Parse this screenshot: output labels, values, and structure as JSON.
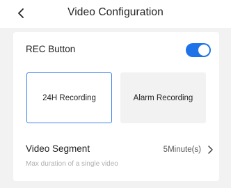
{
  "header": {
    "title": "Video Configuration",
    "back_icon": "chevron-left-icon"
  },
  "rec_button": {
    "label": "REC Button",
    "enabled": true,
    "toggle_color": "#1e73e8"
  },
  "modes": [
    {
      "label": "24H Recording",
      "selected": true
    },
    {
      "label": "Alarm Recording",
      "selected": false
    }
  ],
  "video_segment": {
    "label": "Video Segment",
    "description": "Max duration of a single video",
    "value": "5Minute(s)",
    "chevron_icon": "chevron-right-icon"
  },
  "colors": {
    "accent": "#1e73e8",
    "background": "#f2f2f2"
  }
}
